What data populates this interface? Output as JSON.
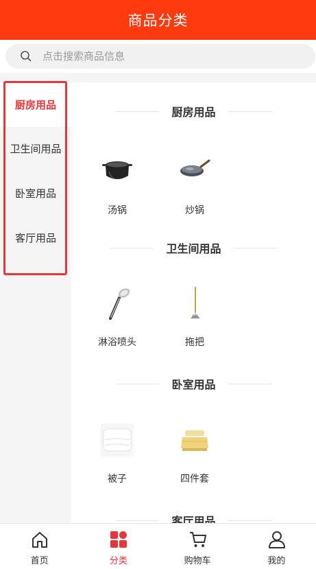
{
  "header": {
    "title": "商品分类"
  },
  "search": {
    "placeholder": "点击搜索商品信息"
  },
  "sidebar": {
    "items": [
      {
        "label": "厨房用品",
        "active": true
      },
      {
        "label": "卫生间用品",
        "active": false
      },
      {
        "label": "卧室用品",
        "active": false
      },
      {
        "label": "客厅用品",
        "active": false
      }
    ]
  },
  "sections": [
    {
      "title": "厨房用品",
      "products": [
        {
          "name": "汤锅",
          "icon": "soup-pot-icon"
        },
        {
          "name": "炒锅",
          "icon": "wok-icon"
        }
      ]
    },
    {
      "title": "卫生间用品",
      "products": [
        {
          "name": "淋浴喷头",
          "icon": "shower-head-icon"
        },
        {
          "name": "拖把",
          "icon": "mop-icon"
        }
      ]
    },
    {
      "title": "卧室用品",
      "products": [
        {
          "name": "被子",
          "icon": "quilt-icon"
        },
        {
          "name": "四件套",
          "icon": "bedding-set-icon"
        }
      ]
    },
    {
      "title": "客厅用品",
      "products": []
    }
  ],
  "tabbar": {
    "items": [
      {
        "label": "首页",
        "icon": "home-icon",
        "active": false
      },
      {
        "label": "分类",
        "icon": "category-icon",
        "active": true
      },
      {
        "label": "购物车",
        "icon": "cart-icon",
        "active": false
      },
      {
        "label": "我的",
        "icon": "user-icon",
        "active": false
      }
    ]
  },
  "colors": {
    "brand": "#ff3a0f",
    "accent": "#e8343b",
    "sidebar_bg": "#f5f5f5"
  }
}
